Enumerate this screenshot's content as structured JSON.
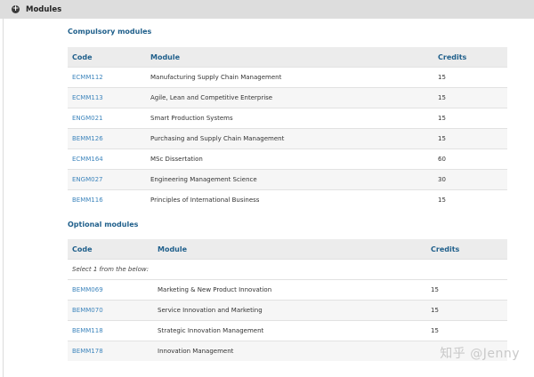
{
  "header": {
    "title": "Modules",
    "toggle_icon": "plus-circle-icon"
  },
  "compulsory": {
    "title": "Compulsory modules",
    "headers": {
      "code": "Code",
      "module": "Module",
      "credits": "Credits"
    },
    "rows": [
      {
        "code": "ECMM112",
        "module": "Manufacturing Supply Chain Management",
        "credits": "15"
      },
      {
        "code": "ECMM113",
        "module": "Agile, Lean and Competitive Enterprise",
        "credits": "15"
      },
      {
        "code": "ENGM021",
        "module": "Smart Production Systems",
        "credits": "15"
      },
      {
        "code": "BEMM126",
        "module": "Purchasing and Supply Chain Management",
        "credits": "15"
      },
      {
        "code": "ECMM164",
        "module": "MSc Dissertation",
        "credits": "60"
      },
      {
        "code": "ENGM027",
        "module": "Engineering Management Science",
        "credits": "30"
      },
      {
        "code": "BEMM116",
        "module": "Principles of International Business",
        "credits": "15"
      }
    ]
  },
  "optional": {
    "title": "Optional modules",
    "headers": {
      "code": "Code",
      "module": "Module",
      "credits": "Credits"
    },
    "note": "Select 1 from the below:",
    "rows": [
      {
        "code": "BEMM069",
        "module": "Marketing & New Product Innovation",
        "credits": "15"
      },
      {
        "code": "BEMM070",
        "module": "Service Innovation and Marketing",
        "credits": "15"
      },
      {
        "code": "BEMM118",
        "module": "Strategic Innovation Management",
        "credits": "15"
      },
      {
        "code": "BEMM178",
        "module": "Innovation Management",
        "credits": ""
      }
    ]
  },
  "watermark": "知乎 @Jenny"
}
